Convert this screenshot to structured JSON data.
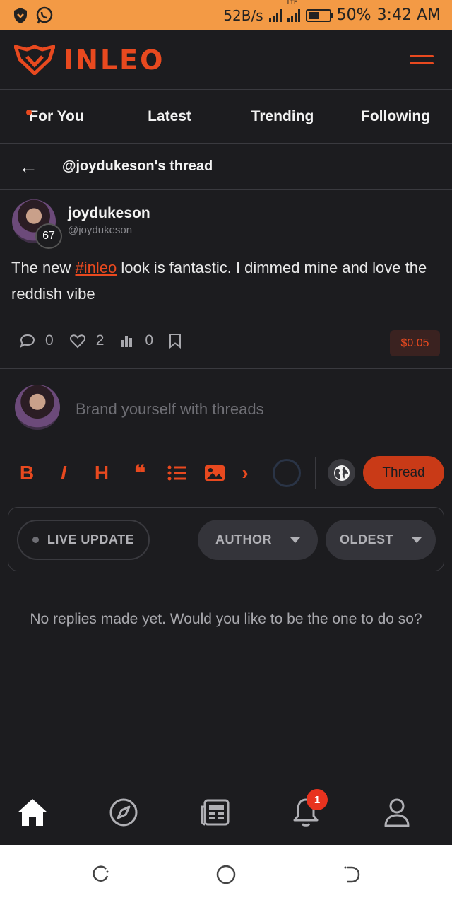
{
  "status_bar": {
    "net_speed": "52B/s",
    "network_type": "LTE",
    "battery": "50%",
    "battery_level": 0.5,
    "time": "3:42 AM",
    "icons": [
      "shield-icon",
      "whatsapp-icon",
      "signal-icon",
      "battery-icon"
    ]
  },
  "header": {
    "logo_text": "INLEO",
    "menu_icon": "hamburger-icon"
  },
  "tabs": [
    {
      "label": "For You",
      "active": true
    },
    {
      "label": "Latest"
    },
    {
      "label": "Trending"
    },
    {
      "label": "Following"
    }
  ],
  "thread_header": {
    "back_symbol": "←",
    "title": "@joydukeson's thread"
  },
  "post": {
    "display_name": "joydukeson",
    "handle": "@joydukeson",
    "reputation": "67",
    "text_before": "The new ",
    "hashtag": "#inleo",
    "text_after": " look is fantastic. I dimmed mine and love the reddish vibe",
    "comments": "0",
    "likes": "2",
    "views": "0",
    "payout": "$0.05"
  },
  "composer": {
    "placeholder": "Brand yourself with threads",
    "submit_label": "Thread"
  },
  "toolbar": {
    "bold": "B",
    "italic": "I",
    "heading": "H",
    "quote": "❝",
    "more": "›"
  },
  "filters": {
    "live_update": "LIVE UPDATE",
    "author": "AUTHOR",
    "oldest": "OLDEST"
  },
  "empty_state": "No replies made yet. Would you like to be the one to do so?",
  "bottom_nav": {
    "items": [
      "home-icon",
      "explore-icon",
      "news-icon",
      "notifications-icon",
      "profile-icon"
    ],
    "notification_badge": "1"
  },
  "colors": {
    "accent": "#e8491f",
    "background": "#1c1c1f",
    "status_bar": "#f39a45",
    "thread_button": "#c93a17"
  }
}
